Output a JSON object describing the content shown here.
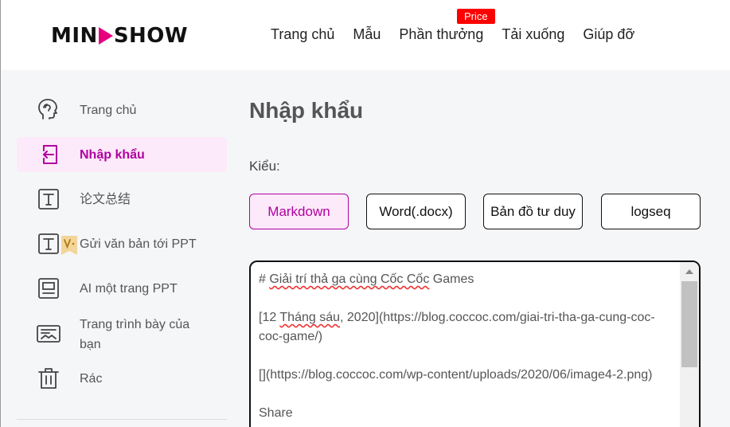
{
  "header": {
    "logo": {
      "left": "MIN",
      "right": "SHOW"
    },
    "nav": [
      "Trang chủ",
      "Mẫu",
      "Phần thưởng",
      "Tải xuống",
      "Giúp đỡ"
    ],
    "badge": "Price"
  },
  "sidebar": {
    "items": [
      {
        "label": "Trang chủ",
        "icon": "brain-icon"
      },
      {
        "label": "Nhập khẩu",
        "icon": "import-icon"
      },
      {
        "label": "论文总结",
        "icon": "text-t-icon"
      },
      {
        "label": "Gửi văn bản tới PPT",
        "icon": "text-vip-icon"
      },
      {
        "label": "AI một trang PPT",
        "icon": "slide-icon"
      },
      {
        "label": "Trang trình bày của bạn",
        "icon": "presentation-icon"
      },
      {
        "label": "Rác",
        "icon": "trash-icon"
      }
    ]
  },
  "main": {
    "title": "Nhập khẩu",
    "type_label": "Kiểu:",
    "types": [
      "Markdown",
      "Word(.docx)",
      "Bản đồ tư duy",
      "logseq"
    ],
    "editor": {
      "line1_prefix": "# ",
      "line1_sq": "Giải trí thả ga cùng Cốc Cốc",
      "line1_suffix": " Games",
      "line2_open": "[12 ",
      "line2_sq": "Tháng sáu",
      "line2_rest": ", 2020](https://blog.coccoc.com/giai-tri-tha-ga-cung-coc-coc-game/)",
      "line3": "[](https://blog.coccoc.com/wp-content/uploads/2020/06/image4-2.png)",
      "line4": "Share"
    }
  },
  "colors": {
    "accent": "#b000a0",
    "logo_play": "#e6007e",
    "badge": "#ff0000"
  }
}
